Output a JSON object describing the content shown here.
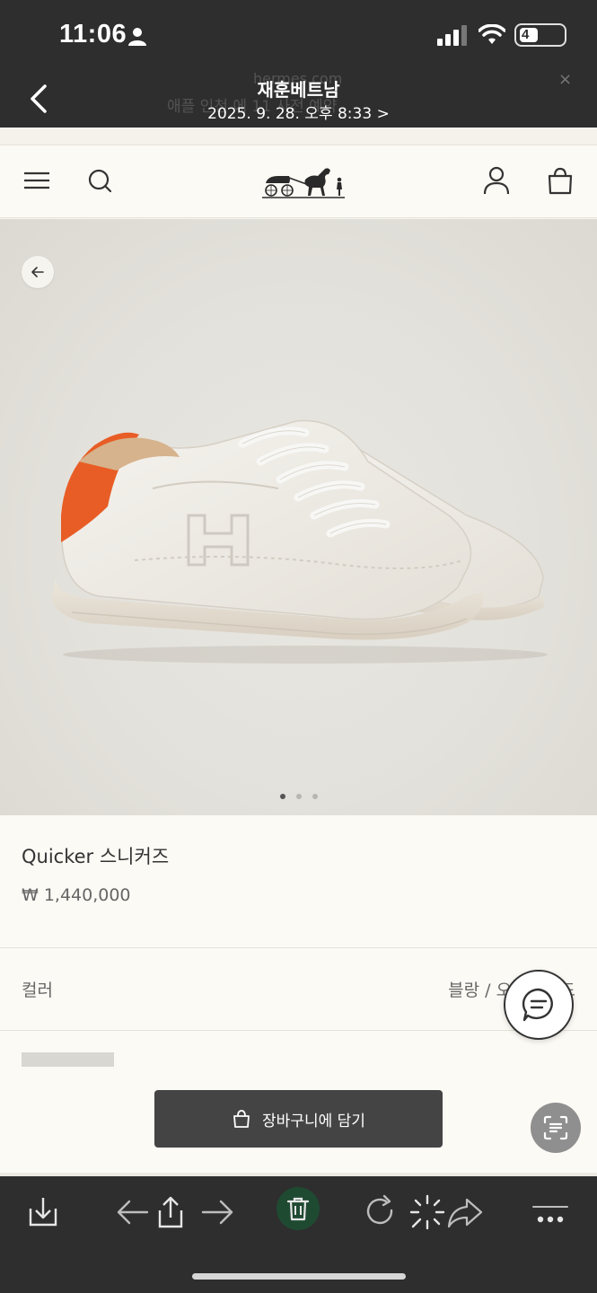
{
  "status_bar": {
    "time": "11:06",
    "battery": "4"
  },
  "viewer": {
    "title": "재훈베트남",
    "subtitle": "2025. 9. 28. 오후 8:33 >",
    "ghost_url": "hermes.com",
    "ghost_banner": "애플 인천 에   11 사전 예약",
    "ghost_close": "×"
  },
  "page": {
    "product": {
      "name": "Quicker 스니커즈",
      "price": "₩ 1,440,000"
    },
    "color": {
      "label": "컬러",
      "value": "블랑 / 오렌지 / 드"
    },
    "cart_button": {
      "label": "장바구니에 담기"
    },
    "carousel": {
      "count": 3,
      "active_index": 0
    }
  },
  "icons": {
    "nav": [
      "menu-icon",
      "search-icon",
      "account-icon",
      "bag-icon"
    ],
    "toolbar": [
      "download-icon",
      "arrow-left-icon",
      "share-icon",
      "arrow-right-icon",
      "trash-icon",
      "rotate-icon",
      "magic-icon",
      "forward-icon",
      "more-icon"
    ]
  },
  "colors": {
    "accent_orange": "#e85d25",
    "trash_bg": "#1f4a32",
    "cart_button": "#444444"
  }
}
